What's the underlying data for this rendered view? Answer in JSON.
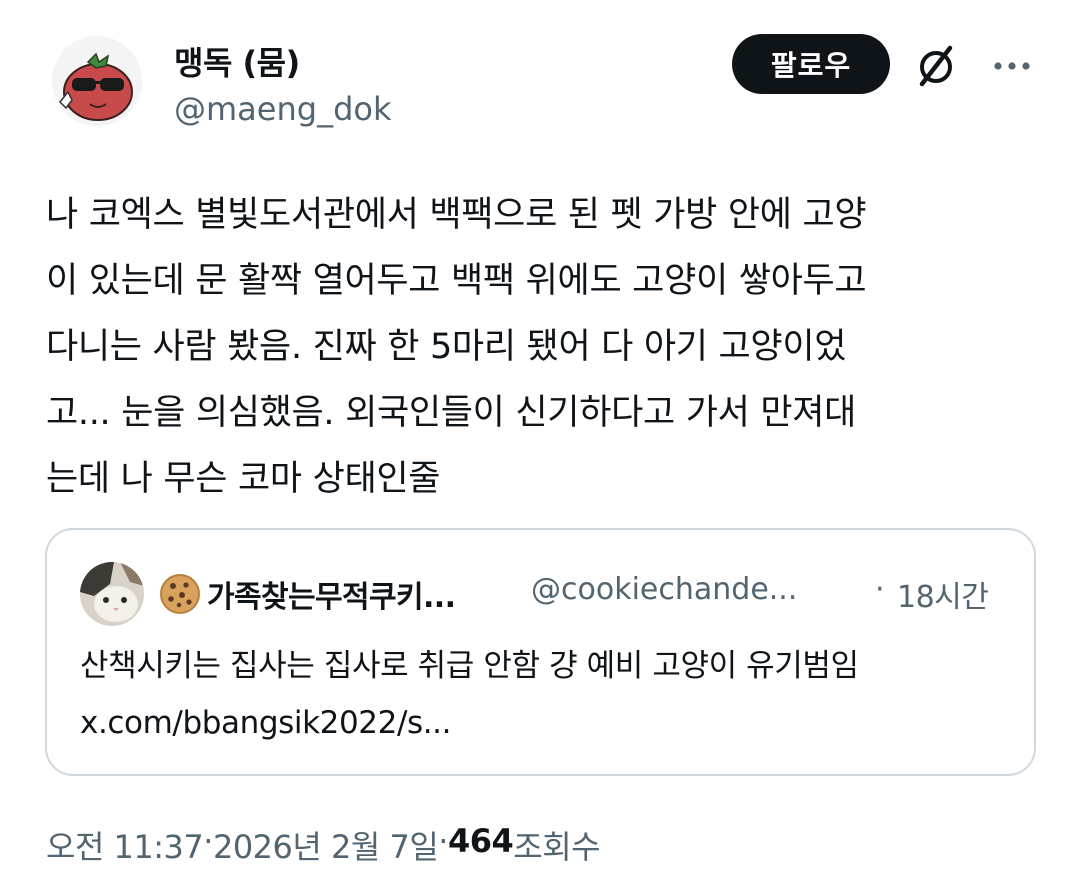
{
  "author": {
    "display_name": "맹독 (뭄)",
    "handle": "@maeng_dok",
    "avatar_icon": "tomato-with-sunglasses-avatar"
  },
  "header": {
    "follow_label": "팔로우",
    "grok_icon": "grok-icon",
    "more_icon": "more-horizontal-icon"
  },
  "tweet": {
    "text": "나 코엑스 별빛도서관에서 백팩으로 된 펫 가방 안에 고양\n이 있는데 문 활짝 열어두고 백팩 위에도 고양이 쌓아두고\n다니는 사람 봤음. 진짜 한 5마리 됐어 다 아기 고양이었\n고... 눈을 의심했음. 외국인들이 신기하다고 가서 만져대\n는데 나 무슨 코마 상태인줄"
  },
  "quote": {
    "avatar_icon": "cat-avatar",
    "name_emoji_icon": "cookie-icon",
    "name": "가족찾는무적쿠키...",
    "handle": "@cookiechande...",
    "separator": "·",
    "time": "18시간",
    "text": "산책시키는 집사는 집사로 취급 안함 걍 예비 고양이 유기범임\nx.com/bbangsik2022/s..."
  },
  "meta": {
    "time": "오전 11:37",
    "sep1": " · ",
    "date": "2026년 2월 7일",
    "sep2": " · ",
    "views_count": "464",
    "views_label": " 조회수"
  },
  "colors": {
    "text": "#0f1419",
    "secondary": "#536471",
    "border": "#cfd9de",
    "button_bg": "#0f1419"
  }
}
